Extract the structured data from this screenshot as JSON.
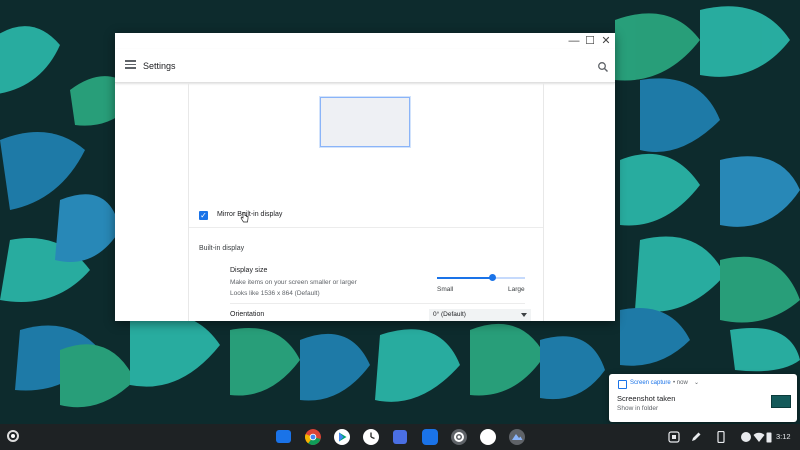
{
  "window": {
    "title": "Settings",
    "minimize_glyph": "—",
    "maximize_glyph": "☐",
    "close_glyph": "✕"
  },
  "display": {
    "mirror_label": "Mirror Built-in display",
    "mirror_checked": true,
    "section_heading": "Built-in display",
    "display_size": {
      "title": "Display size",
      "description": "Make items on your screen smaller or larger",
      "resolution": "Looks like 1536 x 864 (Default)",
      "slider_value_fraction": 0.62,
      "min_label": "Small",
      "max_label": "Large"
    },
    "orientation": {
      "label": "Orientation",
      "value": "0° (Default)"
    }
  },
  "notification": {
    "app": "Screen capture",
    "time": "• now",
    "caret": "⌄",
    "title": "Screenshot taken",
    "action": "Show in folder"
  },
  "shelf": {
    "apps": [
      "files-icon",
      "chrome-icon",
      "play-store-icon",
      "clock-icon",
      "calendar-icon",
      "messages-icon",
      "settings-icon",
      "photos-icon",
      "camera-icon"
    ],
    "clock": "3:12"
  },
  "colors": {
    "accent": "#1a73e8",
    "wallpaper_bg": "#0d2b2d",
    "leaf_teal": "#2ab3a6",
    "leaf_blue": "#1f7fae",
    "leaf_green": "#2aa57e"
  }
}
